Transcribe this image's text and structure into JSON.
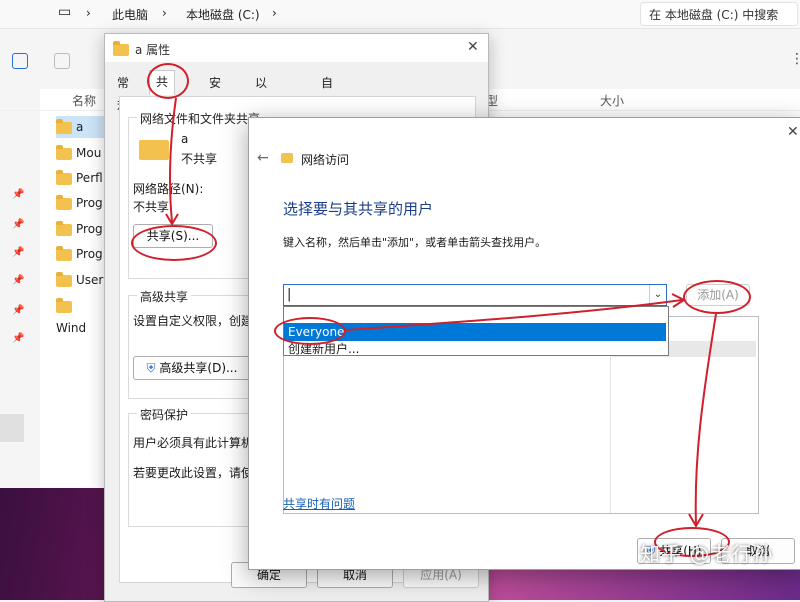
{
  "explorer": {
    "breadcrumb": [
      "此电脑",
      "本地磁盘 (C:)"
    ],
    "search_placeholder": "在 本地磁盘 (C:) 中搜索",
    "columns": {
      "name": "名称",
      "type": "型",
      "size": "大小"
    },
    "files": [
      "a",
      "Mou",
      "Perfl",
      "Prog",
      "Prog",
      "Prog",
      "User",
      "Wind"
    ]
  },
  "props": {
    "title": "a 属性",
    "tabs": [
      "常规",
      "共享",
      "安全",
      "以前的版本",
      "自定义"
    ],
    "active_tab": "共享",
    "section_network": "网络文件和文件夹共享",
    "folder_name": "a",
    "folder_status": "不共享",
    "path_label": "网络路径(N):",
    "path_value": "不共享",
    "share_button": "共享(S)...",
    "section_advanced": "高级共享",
    "advanced_desc": "设置自定义权限，创建",
    "advanced_button": "高级共享(D)...",
    "section_password": "密码保护",
    "password_desc1": "用户必须具有此计算机",
    "password_desc2": "若要更改此设置，请使",
    "ok": "确定",
    "cancel": "取消",
    "apply": "应用(A)"
  },
  "net": {
    "title": "网络访问",
    "heading": "选择要与其共享的用户",
    "instruction": "键入名称，然后单击\"添加\"，或者单击箭头查找用户。",
    "add_button": "添加(A)",
    "options": [
      "Everyone",
      "创建新用户..."
    ],
    "selected_option": "Everyone",
    "help_link": "共享时有问题",
    "share_button": "共享(H)",
    "cancel_button": "取消"
  },
  "watermark": "知乎 @老行孙",
  "colors": {
    "accent": "#0078d7",
    "annotation": "#d0202c",
    "link": "#1a5fb4"
  }
}
